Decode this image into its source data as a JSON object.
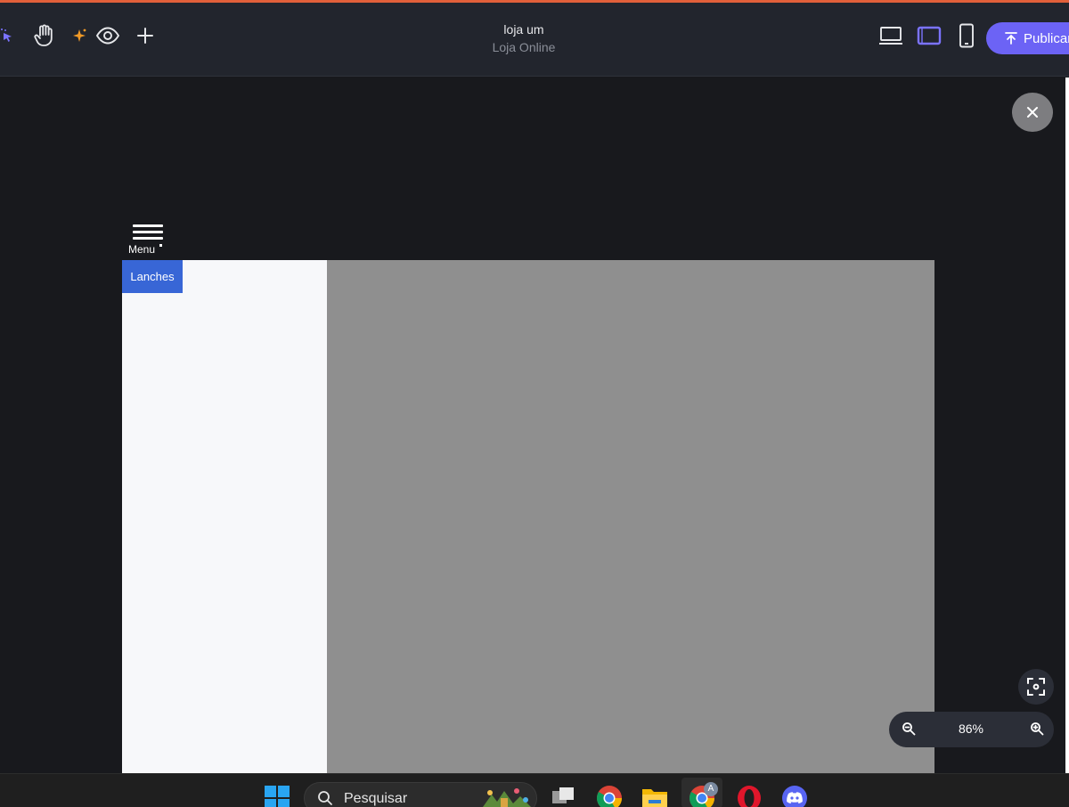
{
  "topbar": {
    "title": "loja um",
    "subtitle": "Loja Online",
    "publish_label": "Publicar",
    "tools": [
      "select-icon",
      "hand-icon",
      "sparkle-icon",
      "eye-icon",
      "plus-icon"
    ],
    "devices": [
      "desktop-icon",
      "tablet-icon",
      "phone-icon"
    ],
    "colors": {
      "accent": "#6c63f5",
      "top_line": "#e2603a",
      "sparkle": "#f29a27"
    }
  },
  "canvas": {
    "menu_label": "Menu",
    "category_button": "Lanches",
    "colors": {
      "category_bg": "#3866d6",
      "content_bg": "#8f8f8f",
      "sidebar_bg": "#f7f8fa"
    }
  },
  "zoom": {
    "value": "86%"
  },
  "taskbar": {
    "search_placeholder": "Pesquisar",
    "apps": [
      "windows-start-icon",
      "task-view-icon",
      "chrome-icon",
      "file-explorer-icon",
      "chrome-profile-icon",
      "opera-icon",
      "discord-icon"
    ],
    "chrome_profile_badge": "A"
  }
}
